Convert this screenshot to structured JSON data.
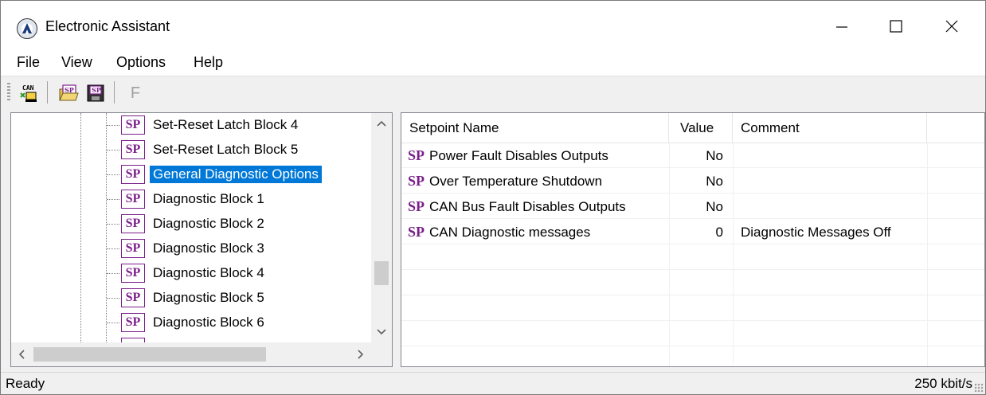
{
  "window": {
    "title": "Electronic Assistant"
  },
  "menu": {
    "items": [
      {
        "label": "File"
      },
      {
        "label": "View"
      },
      {
        "label": "Options"
      },
      {
        "label": "Help"
      }
    ]
  },
  "toolbar": {
    "can_label": "CAN",
    "sp_label": "SP",
    "f_label": "F"
  },
  "tree": {
    "items": [
      {
        "icon": "SP",
        "label": "Set-Reset Latch Block 4"
      },
      {
        "icon": "SP",
        "label": "Set-Reset Latch Block 5"
      },
      {
        "icon": "SP",
        "label": "General Diagnostic Options",
        "selected": true
      },
      {
        "icon": "SP",
        "label": "Diagnostic Block 1"
      },
      {
        "icon": "SP",
        "label": "Diagnostic Block 2"
      },
      {
        "icon": "SP",
        "label": "Diagnostic Block 3"
      },
      {
        "icon": "SP",
        "label": "Diagnostic Block 4"
      },
      {
        "icon": "SP",
        "label": "Diagnostic Block 5"
      },
      {
        "icon": "SP",
        "label": "Diagnostic Block 6"
      }
    ]
  },
  "setpoints": {
    "columns": {
      "name": "Setpoint Name",
      "value": "Value",
      "comment": "Comment"
    },
    "rows": [
      {
        "icon": "SP",
        "name": "Power Fault Disables Outputs",
        "value": "No",
        "comment": ""
      },
      {
        "icon": "SP",
        "name": "Over Temperature Shutdown",
        "value": "No",
        "comment": ""
      },
      {
        "icon": "SP",
        "name": "CAN Bus Fault Disables Outputs",
        "value": "No",
        "comment": ""
      },
      {
        "icon": "SP",
        "name": "CAN Diagnostic messages",
        "value": "0",
        "comment": "Diagnostic Messages Off"
      }
    ]
  },
  "status": {
    "text": "Ready",
    "rate": "250 kbit/s"
  },
  "colors": {
    "selection": "#0078d7",
    "sp_icon": "#7a1f8a"
  }
}
